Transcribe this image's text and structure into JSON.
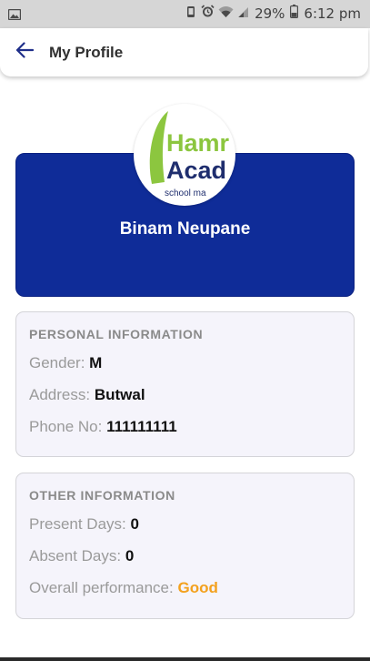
{
  "status_bar": {
    "battery": "29%",
    "time": "6:12 pm"
  },
  "app_bar": {
    "title": "My Profile"
  },
  "profile": {
    "name": "Binam Neupane",
    "logo_text_line1": "Hamr",
    "logo_text_line2": "Acad",
    "logo_text_line3": "school ma"
  },
  "personal": {
    "section_title": "PERSONAL INFORMATION",
    "gender_label": "Gender:",
    "gender_value": "M",
    "address_label": "Address:",
    "address_value": "Butwal",
    "phone_label": "Phone No:",
    "phone_value": "111111111"
  },
  "other": {
    "section_title": "OTHER INFORMATION",
    "present_label": "Present Days:",
    "present_value": "0",
    "absent_label": "Absent Days:",
    "absent_value": "0",
    "performance_label": "Overall performance:",
    "performance_value": "Good"
  },
  "colors": {
    "header_blue": "#0f2c98",
    "accent_good": "#f3a11e",
    "logo_green": "#8cc63f",
    "logo_navy": "#1f2e6e"
  }
}
